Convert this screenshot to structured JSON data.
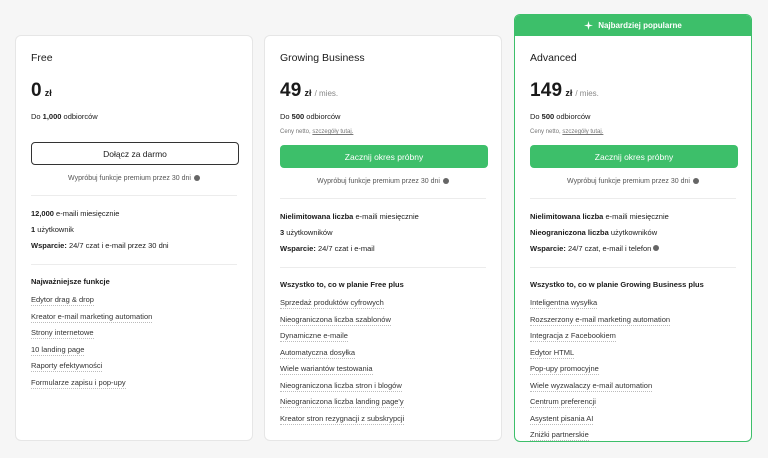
{
  "plans": [
    {
      "name": "Free",
      "price": "0",
      "currency": "zł",
      "period": "",
      "subscribers_prefix": "Do ",
      "subscribers_value": "1,000",
      "subscribers_suffix": " odbiorców",
      "note_text": "",
      "note_link": "",
      "cta": "Dołącz za darmo",
      "trial": "Wypróbuj funkcje premium przez 30 dni",
      "limits": [
        {
          "bold": "12,000",
          "text": " e-maili miesięcznie"
        },
        {
          "bold": "1",
          "text": " użytkownik"
        },
        {
          "bold": "Wsparcie:",
          "text": " 24/7 czat i e-mail przez 30 dni"
        }
      ],
      "features_heading": "Najważniejsze funkcje",
      "features": [
        "Edytor drag & drop",
        "Kreator e-mail marketing automation",
        "Strony internetowe",
        "10 landing page",
        "Raporty efektywności",
        "Formularze zapisu i pop-upy"
      ]
    },
    {
      "name": "Growing Business",
      "price": "49",
      "currency": "zł",
      "period": "/ mies.",
      "subscribers_prefix": "Do ",
      "subscribers_value": "500",
      "subscribers_suffix": " odbiorców",
      "note_text": "Ceny netto, ",
      "note_link": "szczegóły tutaj.",
      "cta": "Zacznij okres próbny",
      "trial": "Wypróbuj funkcje premium przez 30 dni",
      "limits": [
        {
          "bold": "Nielimitowana liczba",
          "text": " e-maili miesięcznie"
        },
        {
          "bold": "3",
          "text": " użytkowników"
        },
        {
          "bold": "Wsparcie:",
          "text": " 24/7 czat i e-mail"
        }
      ],
      "features_heading": "Wszystko to, co w planie Free plus",
      "features": [
        "Sprzedaż produktów cyfrowych",
        "Nieograniczona liczba szablonów",
        "Dynamiczne e-maile",
        "Automatyczna dosyłka",
        "Wiele wariantów testowania",
        "Nieograniczona liczba stron i blogów",
        "Nieograniczona liczba landing page'y",
        "Kreator stron rezygnacji z subskrypcji"
      ]
    },
    {
      "banner": "Najbardziej popularne",
      "name": "Advanced",
      "price": "149",
      "currency": "zł",
      "period": "/ mies.",
      "subscribers_prefix": "Do ",
      "subscribers_value": "500",
      "subscribers_suffix": " odbiorców",
      "note_text": "Ceny netto, ",
      "note_link": "szczegóły tutaj.",
      "cta": "Zacznij okres próbny",
      "trial": "Wypróbuj funkcje premium przez 30 dni",
      "limits": [
        {
          "bold": "Nielimitowana liczba",
          "text": " e-maili miesięcznie"
        },
        {
          "bold": "Nieograniczona liczba",
          "text": " użytkowników"
        },
        {
          "bold": "Wsparcie:",
          "text": " 24/7 czat, e-mail i telefon"
        }
      ],
      "features_heading": "Wszystko to, co w planie Growing Business plus",
      "features": [
        "Inteligentna wysyłka",
        "Rozszerzony e-mail marketing automation",
        "Integracja z Facebookiem",
        "Edytor HTML",
        "Pop-upy promocyjne",
        "Wiele wyzwalaczy e-mail automation",
        "Centrum preferencji",
        "Asystent pisania AI",
        "Zniżki partnerskie"
      ]
    }
  ],
  "colors": {
    "accent": "#3dbf6a",
    "border": "#e6e6e6",
    "background": "#f6f6f6"
  },
  "icons": {
    "banner": "sparkle-icon",
    "info": "info-icon"
  }
}
